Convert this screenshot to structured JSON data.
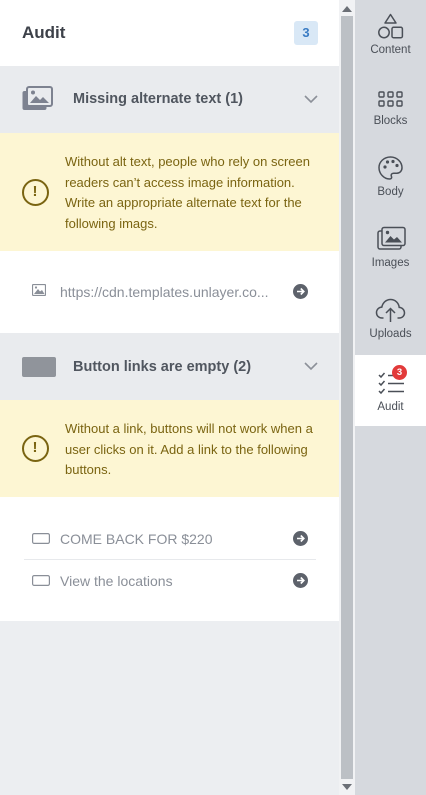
{
  "audit": {
    "title": "Audit",
    "count": "3"
  },
  "sections": [
    {
      "title": "Missing alternate text (1)",
      "warning": "Without alt text, people who rely on screen readers can’t access image information. Write an appropriate alternate text for the following imags.",
      "items": [
        {
          "icon": "image-icon",
          "text": "https://cdn.templates.unlayer.co..."
        }
      ]
    },
    {
      "title": "Button links are empty (2)",
      "warning": "Without a link, buttons will not work when a user clicks on it. Add a link to the following buttons.",
      "items": [
        {
          "icon": "button-icon",
          "text": "COME BACK FOR $220"
        },
        {
          "icon": "button-icon",
          "text": "View the locations"
        }
      ]
    }
  ],
  "rail": {
    "items": [
      {
        "label": "Content",
        "icon": "shapes-icon"
      },
      {
        "label": "Blocks",
        "icon": "grid-icon"
      },
      {
        "label": "Body",
        "icon": "palette-icon"
      },
      {
        "label": "Images",
        "icon": "images-icon"
      },
      {
        "label": "Uploads",
        "icon": "cloud-upload-icon"
      },
      {
        "label": "Audit",
        "icon": "checklist-icon",
        "badge": "3",
        "active": true
      }
    ]
  },
  "colors": {
    "warning_bg": "#fdf6d3",
    "warning_text": "#7a6411",
    "badge": "#e23a3a",
    "count_bg": "#d9e8f6"
  }
}
